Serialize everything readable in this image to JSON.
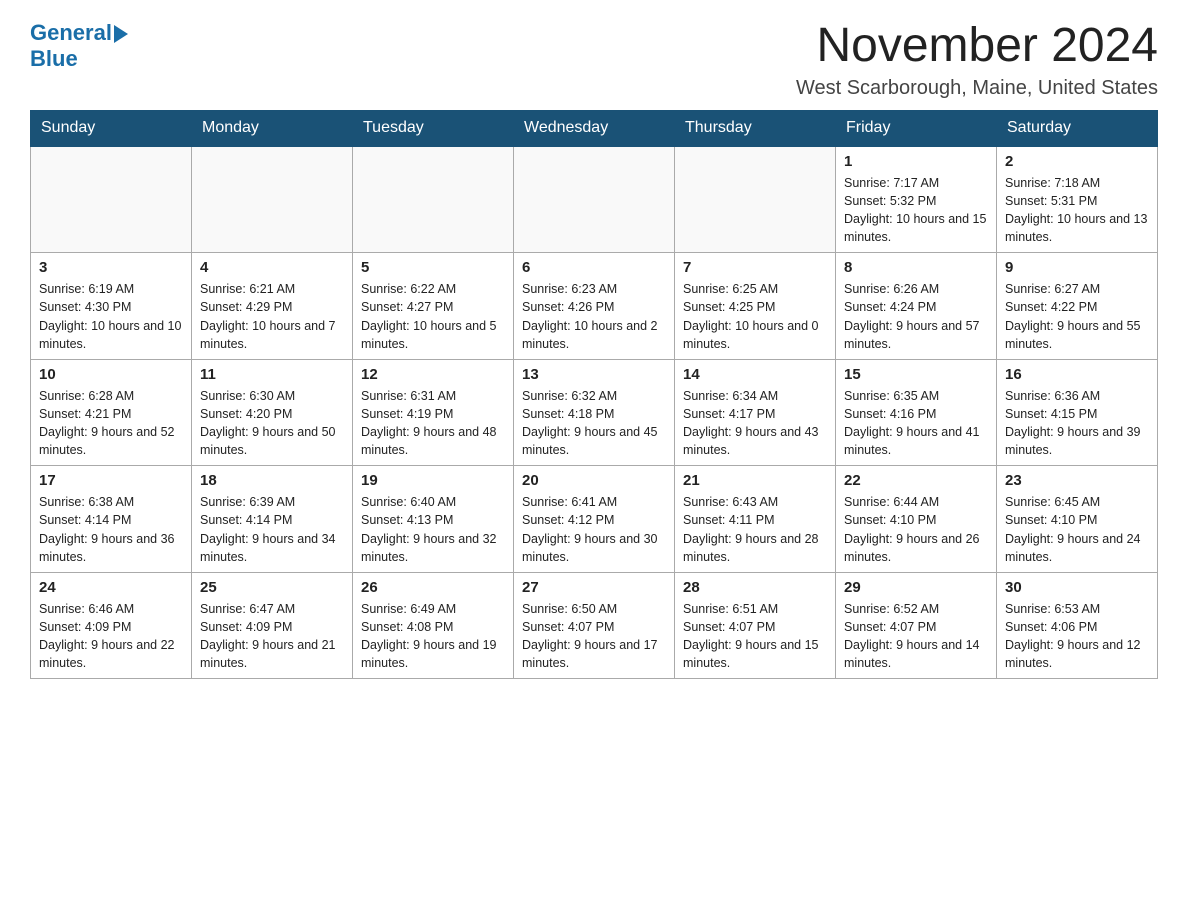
{
  "logo": {
    "general": "General",
    "blue": "Blue"
  },
  "title": "November 2024",
  "location": "West Scarborough, Maine, United States",
  "days_of_week": [
    "Sunday",
    "Monday",
    "Tuesday",
    "Wednesday",
    "Thursday",
    "Friday",
    "Saturday"
  ],
  "weeks": [
    [
      {
        "day": "",
        "info": ""
      },
      {
        "day": "",
        "info": ""
      },
      {
        "day": "",
        "info": ""
      },
      {
        "day": "",
        "info": ""
      },
      {
        "day": "",
        "info": ""
      },
      {
        "day": "1",
        "info": "Sunrise: 7:17 AM\nSunset: 5:32 PM\nDaylight: 10 hours and 15 minutes."
      },
      {
        "day": "2",
        "info": "Sunrise: 7:18 AM\nSunset: 5:31 PM\nDaylight: 10 hours and 13 minutes."
      }
    ],
    [
      {
        "day": "3",
        "info": "Sunrise: 6:19 AM\nSunset: 4:30 PM\nDaylight: 10 hours and 10 minutes."
      },
      {
        "day": "4",
        "info": "Sunrise: 6:21 AM\nSunset: 4:29 PM\nDaylight: 10 hours and 7 minutes."
      },
      {
        "day": "5",
        "info": "Sunrise: 6:22 AM\nSunset: 4:27 PM\nDaylight: 10 hours and 5 minutes."
      },
      {
        "day": "6",
        "info": "Sunrise: 6:23 AM\nSunset: 4:26 PM\nDaylight: 10 hours and 2 minutes."
      },
      {
        "day": "7",
        "info": "Sunrise: 6:25 AM\nSunset: 4:25 PM\nDaylight: 10 hours and 0 minutes."
      },
      {
        "day": "8",
        "info": "Sunrise: 6:26 AM\nSunset: 4:24 PM\nDaylight: 9 hours and 57 minutes."
      },
      {
        "day": "9",
        "info": "Sunrise: 6:27 AM\nSunset: 4:22 PM\nDaylight: 9 hours and 55 minutes."
      }
    ],
    [
      {
        "day": "10",
        "info": "Sunrise: 6:28 AM\nSunset: 4:21 PM\nDaylight: 9 hours and 52 minutes."
      },
      {
        "day": "11",
        "info": "Sunrise: 6:30 AM\nSunset: 4:20 PM\nDaylight: 9 hours and 50 minutes."
      },
      {
        "day": "12",
        "info": "Sunrise: 6:31 AM\nSunset: 4:19 PM\nDaylight: 9 hours and 48 minutes."
      },
      {
        "day": "13",
        "info": "Sunrise: 6:32 AM\nSunset: 4:18 PM\nDaylight: 9 hours and 45 minutes."
      },
      {
        "day": "14",
        "info": "Sunrise: 6:34 AM\nSunset: 4:17 PM\nDaylight: 9 hours and 43 minutes."
      },
      {
        "day": "15",
        "info": "Sunrise: 6:35 AM\nSunset: 4:16 PM\nDaylight: 9 hours and 41 minutes."
      },
      {
        "day": "16",
        "info": "Sunrise: 6:36 AM\nSunset: 4:15 PM\nDaylight: 9 hours and 39 minutes."
      }
    ],
    [
      {
        "day": "17",
        "info": "Sunrise: 6:38 AM\nSunset: 4:14 PM\nDaylight: 9 hours and 36 minutes."
      },
      {
        "day": "18",
        "info": "Sunrise: 6:39 AM\nSunset: 4:14 PM\nDaylight: 9 hours and 34 minutes."
      },
      {
        "day": "19",
        "info": "Sunrise: 6:40 AM\nSunset: 4:13 PM\nDaylight: 9 hours and 32 minutes."
      },
      {
        "day": "20",
        "info": "Sunrise: 6:41 AM\nSunset: 4:12 PM\nDaylight: 9 hours and 30 minutes."
      },
      {
        "day": "21",
        "info": "Sunrise: 6:43 AM\nSunset: 4:11 PM\nDaylight: 9 hours and 28 minutes."
      },
      {
        "day": "22",
        "info": "Sunrise: 6:44 AM\nSunset: 4:10 PM\nDaylight: 9 hours and 26 minutes."
      },
      {
        "day": "23",
        "info": "Sunrise: 6:45 AM\nSunset: 4:10 PM\nDaylight: 9 hours and 24 minutes."
      }
    ],
    [
      {
        "day": "24",
        "info": "Sunrise: 6:46 AM\nSunset: 4:09 PM\nDaylight: 9 hours and 22 minutes."
      },
      {
        "day": "25",
        "info": "Sunrise: 6:47 AM\nSunset: 4:09 PM\nDaylight: 9 hours and 21 minutes."
      },
      {
        "day": "26",
        "info": "Sunrise: 6:49 AM\nSunset: 4:08 PM\nDaylight: 9 hours and 19 minutes."
      },
      {
        "day": "27",
        "info": "Sunrise: 6:50 AM\nSunset: 4:07 PM\nDaylight: 9 hours and 17 minutes."
      },
      {
        "day": "28",
        "info": "Sunrise: 6:51 AM\nSunset: 4:07 PM\nDaylight: 9 hours and 15 minutes."
      },
      {
        "day": "29",
        "info": "Sunrise: 6:52 AM\nSunset: 4:07 PM\nDaylight: 9 hours and 14 minutes."
      },
      {
        "day": "30",
        "info": "Sunrise: 6:53 AM\nSunset: 4:06 PM\nDaylight: 9 hours and 12 minutes."
      }
    ]
  ]
}
